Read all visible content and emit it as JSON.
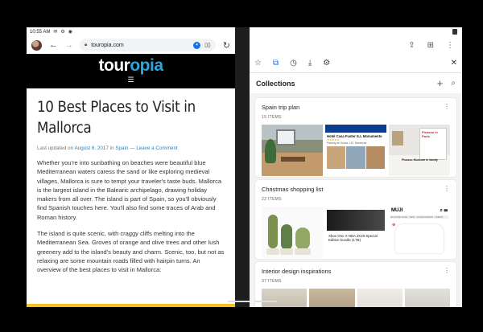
{
  "status": {
    "time": "10:55 AM"
  },
  "browser": {
    "url": "touropia.com"
  },
  "site": {
    "logo_part1": "tour",
    "logo_part2": "opia",
    "title": "10 Best Places to Visit in Mallorca",
    "meta_prefix": "Last updated on ",
    "meta_date": "August 6, 2017",
    "meta_mid": " in ",
    "meta_category": "Spain",
    "meta_sep": " — ",
    "meta_comment": "Leave a Comment",
    "paragraph1": "Whether you're into sunbathing on beaches were beautiful blue Mediterranean waters caress the sand or like exploring medieval villages, Mallorca is sure to tempt your traveler's taste buds. Mallorca is the largest island in the Balearic archipelago, drawing holiday makers from all over. The island is part of Spain, so you'll obviously find Spanish touches here. You'll also find some traces of Arab and Roman history.",
    "paragraph2": "The island is quite scenic, with craggy cliffs melting into the Mediterranean Sea. Groves of orange and olive trees and other lush greenery add to the island's beauty and charm. Scenic, too, but not as relaxing are some mountain roads filled with hairpin turns. An overview of the best places to visit in Mallorca:"
  },
  "collections_panel": {
    "title": "Collections",
    "cards": [
      {
        "title": "Spain trip plan",
        "count": "15 ITEMS",
        "hotel_name": "Hotel Casa Fuster G.L Monumento",
        "hotel_stars": "★★★★★",
        "hotel_addr": "Passeig de Gracia, 132, Barcelona",
        "poster_title": "Picasso in Paris",
        "gallery_text": "Picasso Museum in family"
      },
      {
        "title": "Christmas shopping list",
        "count": "22 ITEMS",
        "xbox_text": "Xbox One X NBA 2K20 Special Edition bundle (1TB)",
        "muji_brand": "MUJI",
        "muji_nav": "MUJI FOR SALE · NEW · ACCESSORIES · LINENS"
      },
      {
        "title": "Interior design inspirations",
        "count": "37 ITEMS"
      }
    ]
  },
  "colors": {
    "accent": "#1a73e8",
    "logo_blue": "#29a8e0",
    "link": "#1e88c8"
  }
}
